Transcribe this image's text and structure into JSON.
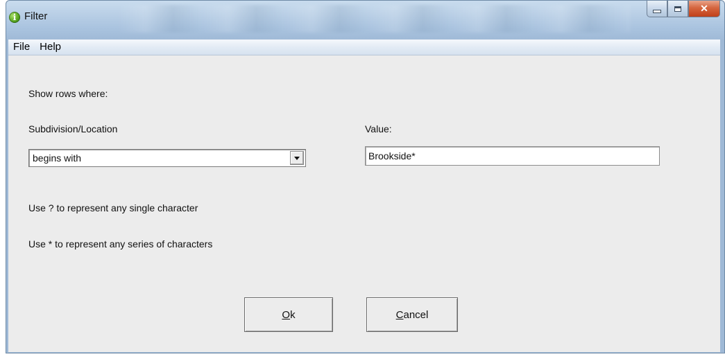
{
  "window": {
    "title": "Filter"
  },
  "menu": {
    "items": [
      "File",
      "Help"
    ]
  },
  "dialog": {
    "instruction": "Show rows where:",
    "field_label": "Subdivision/Location",
    "value_label": "Value:",
    "operator": {
      "selected": "begins with"
    },
    "value_input": {
      "value": "Brookside*"
    },
    "hint_single": "Use ? to represent any single character",
    "hint_series": "Use * to represent any series of characters",
    "ok": {
      "accel": "O",
      "rest": "k"
    },
    "cancel": {
      "accel": "C",
      "rest": "ancel"
    }
  },
  "icons": {
    "app": "info-icon",
    "minimize": "minimize-icon",
    "maximize": "maximize-icon",
    "close": "close-icon",
    "dropdown": "chevron-down-icon"
  },
  "colors": {
    "title_bar": "#b9cfe6",
    "close_button": "#d5653e",
    "dialog_background": "#ececec"
  }
}
